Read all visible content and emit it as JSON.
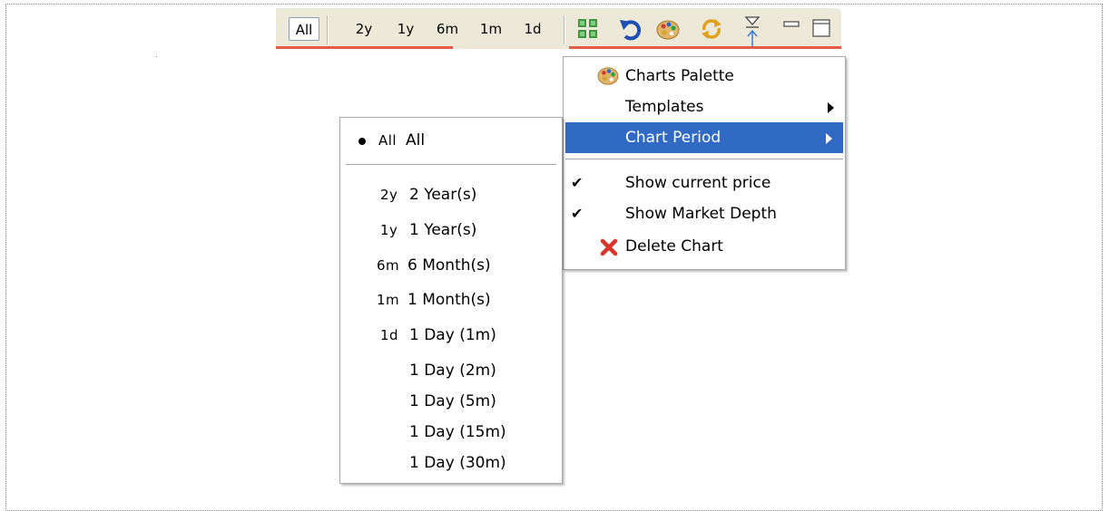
{
  "toolbar": {
    "periods": [
      "All",
      "2y",
      "1y",
      "6m",
      "1m",
      "1d"
    ],
    "active_period": "All",
    "icons": [
      "layout-grid-icon",
      "undo-icon",
      "palette-icon",
      "refresh-icon",
      "view-menu-icon",
      "minimize-icon",
      "maximize-icon"
    ]
  },
  "view_menu": {
    "items": {
      "charts_palette": "Charts Palette",
      "templates": "Templates",
      "chart_period": "Chart Period",
      "show_current_price": "Show current price",
      "show_market_depth": "Show Market Depth",
      "delete_chart": "Delete Chart"
    },
    "checked": [
      "show_current_price",
      "show_market_depth"
    ],
    "highlighted": "chart_period"
  },
  "period_menu": {
    "all": {
      "abbr": "All",
      "label": "All"
    },
    "items": [
      {
        "abbr": "2y",
        "label": "2 Year(s)"
      },
      {
        "abbr": "1y",
        "label": "1 Year(s)"
      },
      {
        "abbr": "6m",
        "label": "6 Month(s)"
      },
      {
        "abbr": "1m",
        "label": "1 Month(s)"
      },
      {
        "abbr": "1d",
        "label": "1 Day (1m)"
      },
      {
        "abbr": "",
        "label": "1 Day (2m)"
      },
      {
        "abbr": "",
        "label": "1 Day (5m)"
      },
      {
        "abbr": "",
        "label": "1 Day (15m)"
      },
      {
        "abbr": "",
        "label": "1 Day (30m)"
      }
    ]
  },
  "colors": {
    "highlight": "#316ac5",
    "toolbar_bg": "#ece9d8",
    "accent_line": "#e35a4b"
  }
}
